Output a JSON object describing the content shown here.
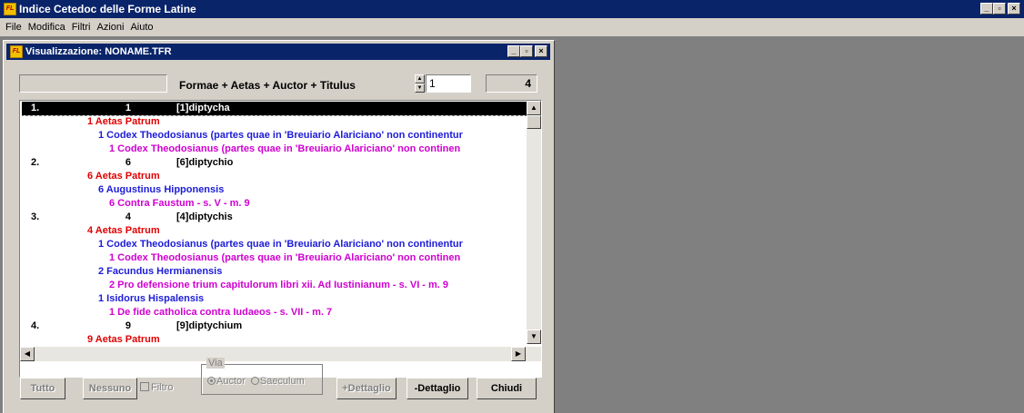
{
  "app": {
    "title": "Indice Cetedoc delle Forme Latine",
    "icon_text": "FL",
    "min": "_",
    "max": "▫",
    "close": "×"
  },
  "menu": [
    {
      "label": "File"
    },
    {
      "label": "Modifica"
    },
    {
      "label": "Filtri"
    },
    {
      "label": "Azioni"
    },
    {
      "label": "Aiuto"
    }
  ],
  "child": {
    "title": "Visualizzazione: NONAME.TFR",
    "header_label": "Formae + Aetas + Auctor + Titulus",
    "page_value": "1",
    "count": "4"
  },
  "list": {
    "rows": [
      {
        "type": "forma",
        "num": "1.",
        "cnt": "1",
        "form": "[1]diptycha",
        "selected": true
      },
      {
        "type": "aetas",
        "text": "1 Aetas Patrum"
      },
      {
        "type": "auctor",
        "text": "1 Codex Theodosianus (partes quae in 'Breuiario Alariciano' non continentur"
      },
      {
        "type": "titulus",
        "text": "1 Codex Theodosianus (partes quae in 'Breuiario Alariciano' non continen"
      },
      {
        "type": "forma",
        "num": "2.",
        "cnt": "6",
        "form": "[6]diptychio"
      },
      {
        "type": "aetas",
        "text": "6 Aetas Patrum"
      },
      {
        "type": "auctor",
        "text": "6 Augustinus Hipponensis"
      },
      {
        "type": "titulus",
        "text": "6 Contra Faustum - s. V - m. 9"
      },
      {
        "type": "forma",
        "num": "3.",
        "cnt": "4",
        "form": "[4]diptychis"
      },
      {
        "type": "aetas",
        "text": "4 Aetas Patrum"
      },
      {
        "type": "auctor",
        "text": "1 Codex Theodosianus (partes quae in 'Breuiario Alariciano' non continentur"
      },
      {
        "type": "titulus",
        "text": "1 Codex Theodosianus (partes quae in 'Breuiario Alariciano' non continen"
      },
      {
        "type": "auctor",
        "text": "2 Facundus Hermianensis"
      },
      {
        "type": "titulus",
        "text": "2 Pro defensione trium capitulorum libri xii. Ad Iustinianum - s. VI - m. 9"
      },
      {
        "type": "auctor",
        "text": "1 Isidorus Hispalensis"
      },
      {
        "type": "titulus",
        "text": "1 De fide catholica contra Iudaeos - s. VII - m. 7"
      },
      {
        "type": "forma",
        "num": "4.",
        "cnt": "9",
        "form": "[9]diptychium"
      },
      {
        "type": "aetas",
        "text": "9 Aetas Patrum"
      }
    ]
  },
  "buttons": {
    "tutto": "Tutto",
    "nessuno": "Nessuno",
    "filtro": "Filtro",
    "via": "Via",
    "auctor": "Auctor",
    "saeculum": "Saeculum",
    "plus_dettaglio": "+Dettaglio",
    "minus_dettaglio": "-Dettaglio",
    "chiudi": "Chiudi"
  }
}
